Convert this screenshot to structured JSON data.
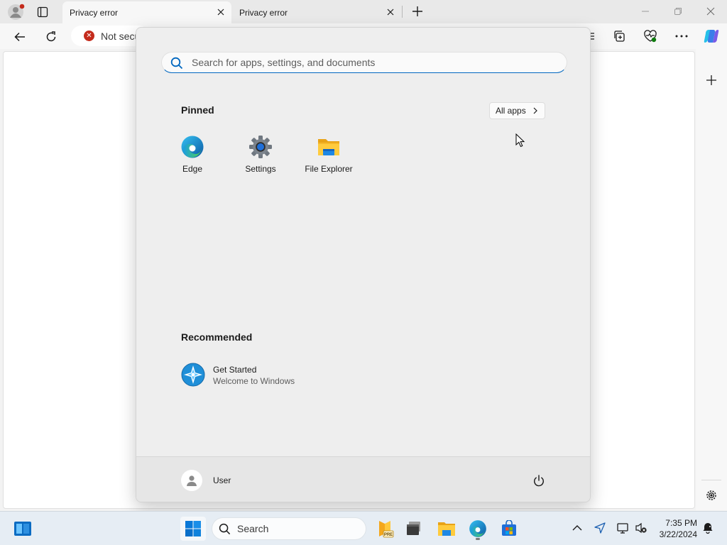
{
  "browser": {
    "tabs": [
      {
        "title": "Privacy error",
        "active": true
      },
      {
        "title": "Privacy error",
        "active": false
      }
    ],
    "address_text": "Not secu",
    "colors": {
      "accent": "#0067c0",
      "warning": "#c42b1c"
    }
  },
  "start_menu": {
    "search_placeholder": "Search for apps, settings, and documents",
    "pinned_title": "Pinned",
    "all_apps_label": "All apps",
    "pinned_apps": [
      {
        "label": "Edge",
        "icon": "edge-icon"
      },
      {
        "label": "Settings",
        "icon": "settings-gear-icon"
      },
      {
        "label": "File Explorer",
        "icon": "folder-icon"
      }
    ],
    "recommended_title": "Recommended",
    "recommended": [
      {
        "title": "Get Started",
        "subtitle": "Welcome to Windows",
        "icon": "get-started-icon"
      }
    ],
    "user_name": "User"
  },
  "taskbar": {
    "search_label": "Search",
    "time": "7:35 PM",
    "date": "3/22/2024"
  }
}
